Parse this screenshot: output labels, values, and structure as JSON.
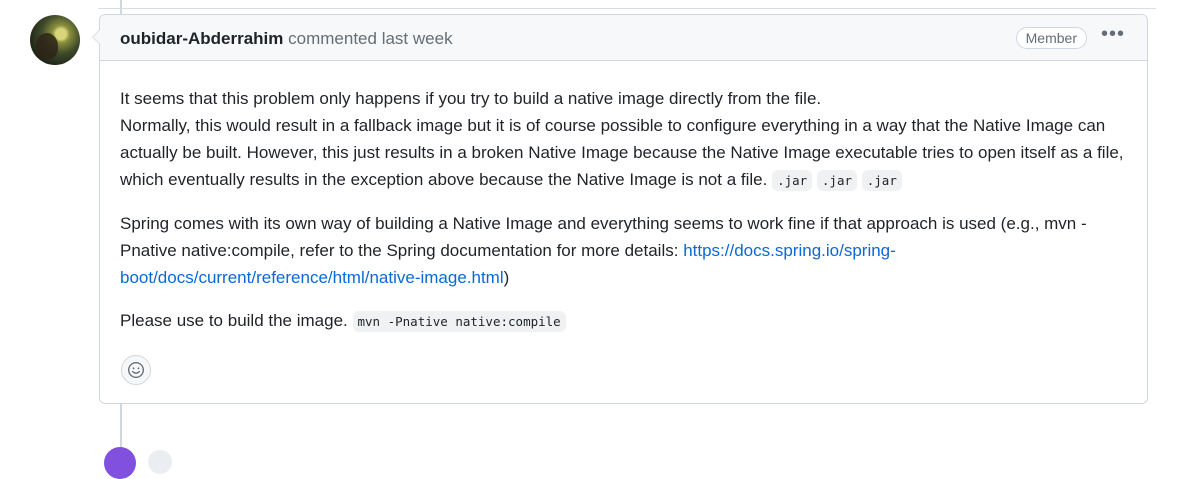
{
  "comment": {
    "author": "oubidar-Abderrahim",
    "action": "commented",
    "time": "last week",
    "role_badge": "Member",
    "menu_icon": "kebab-horizontal-icon",
    "avatar_icon": "user-avatar",
    "body": {
      "p1_line1": "It seems that this problem only happens if you try to build a native image directly from the file.",
      "p1_line2_text": "Normally, this would result in a fallback image but it is of course possible to configure everything in a way that the Native Image can actually be built. However, this just results in a broken Native Image because the Native Image executable tries to open itself as a file, which eventually results in the exception above because the Native Image is not a file.",
      "codes": [
        ".jar",
        ".jar",
        ".jar"
      ],
      "p2_text": "Spring comes with its own way of building a Native Image and everything seems to work fine if that approach is used (e.g., mvn -Pnative native:compile, refer to the Spring documentation for more details: ",
      "p2_link": "https://docs.spring.io/spring-boot/docs/current/reference/html/native-image.html",
      "p2_end": ")",
      "p3_text": "Please use to build the image.",
      "p3_code": "mvn -Pnative native:compile"
    },
    "reaction_icon": "smiley-icon"
  }
}
